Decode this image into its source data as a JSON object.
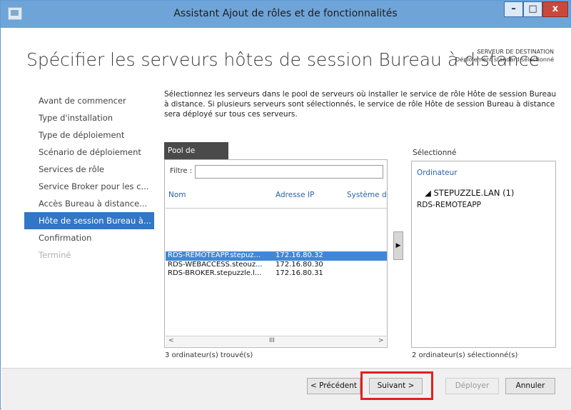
{
  "window": {
    "title": "Assistant Ajout de rôles et de fonctionnalités",
    "minimize_symbol": "–",
    "maximize_symbol": "□",
    "close_symbol": "x"
  },
  "header": {
    "title": "Spécifier les serveurs hôtes de session Bureau à distance",
    "destination_label": "SERVEUR DE DESTINATION",
    "destination_value": "Déploiement standard sélectionné"
  },
  "nav": {
    "items": [
      {
        "label": "Avant de commencer",
        "state": "normal"
      },
      {
        "label": "Type d'installation",
        "state": "normal"
      },
      {
        "label": "Type de déploiement",
        "state": "normal"
      },
      {
        "label": "Scénario de déploiement",
        "state": "normal"
      },
      {
        "label": "Services de rôle",
        "state": "normal"
      },
      {
        "label": "Service Broker pour les c...",
        "state": "normal"
      },
      {
        "label": "Accès Bureau à distance...",
        "state": "normal"
      },
      {
        "label": "Hôte de session Bureau à...",
        "state": "active"
      },
      {
        "label": "Confirmation",
        "state": "normal"
      },
      {
        "label": "Terminé",
        "state": "disabled"
      }
    ]
  },
  "description": "Sélectionnez les serveurs dans le pool de serveurs où installer le service de rôle Hôte de session Bureau à distance. Si plusieurs serveurs sont sélectionnés, le service de rôle Hôte de session Bureau à distance sera déployé sur tous ces serveurs.",
  "pool": {
    "tab_label": "Pool de serveurs",
    "filter_label": "Filtre :",
    "filter_value": "",
    "columns": [
      "Nom",
      "Adresse IP",
      "Système d"
    ],
    "rows": [
      {
        "name": "RDS-REMOTEAPP.stepuz...",
        "ip": "172.16.80.32",
        "selected": true
      },
      {
        "name": "RDS-WEBACCESS.steouz...",
        "ip": "172.16.80.30",
        "selected": false
      },
      {
        "name": "RDS-BROKER.stepuzzle.l...",
        "ip": "172.16.80.31",
        "selected": false
      }
    ],
    "scroll_left": "<",
    "scroll_thumb": "III",
    "scroll_right": ">",
    "count_text": "3 ordinateur(s) trouvé(s)",
    "add_symbol": "▶"
  },
  "selected_panel": {
    "label": "Sélectionné",
    "column": "Ordinateur",
    "group": "◢  STEPUZZLE.LAN (1)",
    "items": [
      "RDS-REMOTEAPP"
    ],
    "count_text": "2 ordinateur(s) sélectionné(s)"
  },
  "footer": {
    "previous": "< Précédent",
    "next": "Suivant >",
    "deploy": "Déployer",
    "cancel": "Annuler",
    "highlight_color": "#e02020"
  },
  "colors": {
    "titlebar": "#6ea4d8",
    "accent": "#3276c6",
    "header_link": "#2a64a6"
  }
}
